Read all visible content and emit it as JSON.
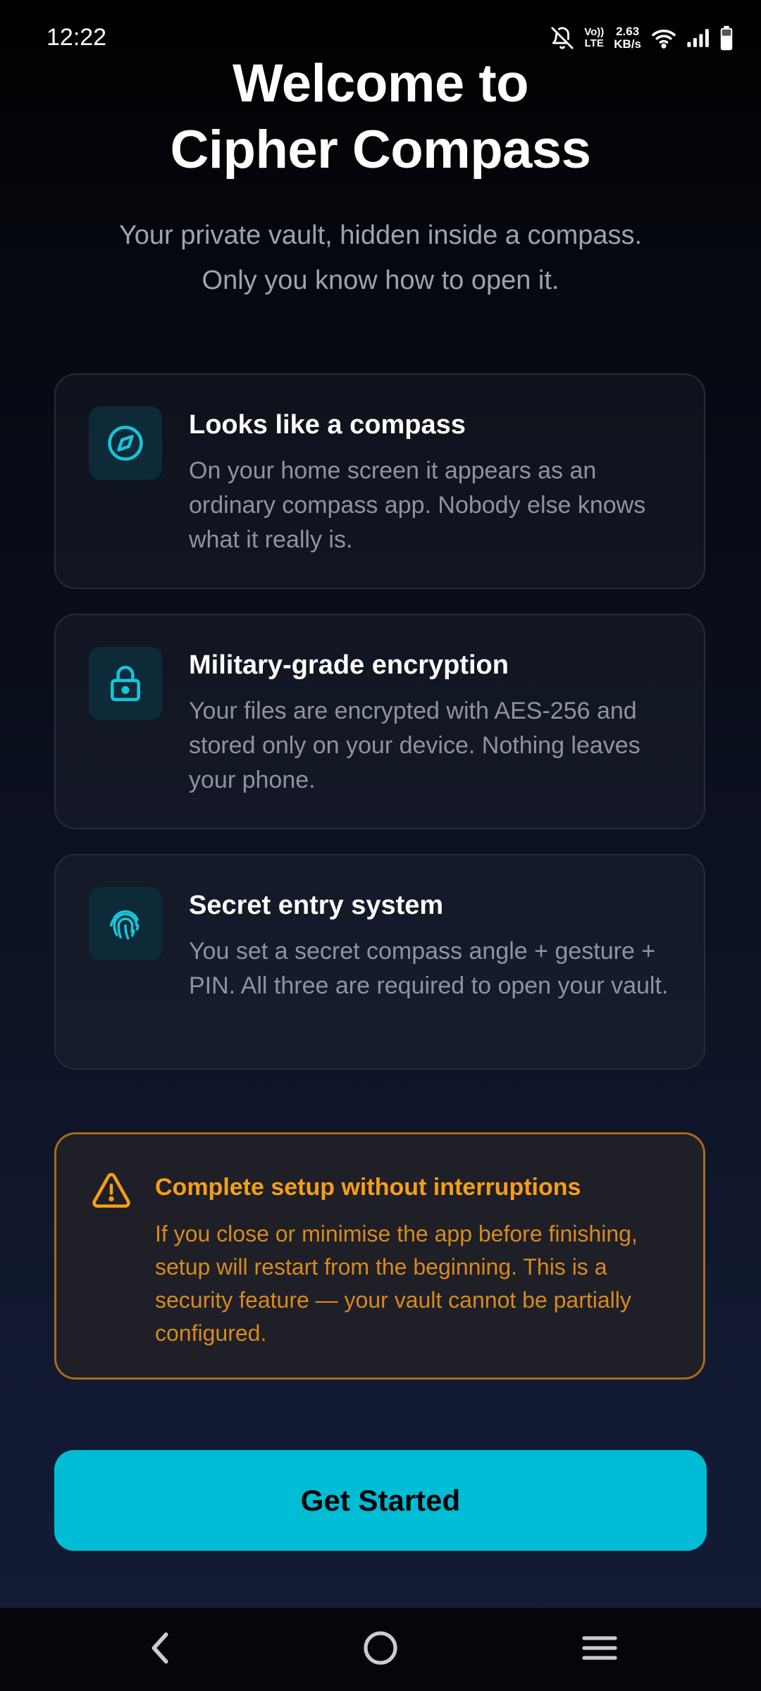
{
  "status_bar": {
    "time": "12:22",
    "volte_top": "Vo))",
    "volte_bottom": "LTE",
    "speed_value": "2.63",
    "speed_unit": "KB/s",
    "icons": [
      "notifications-off-icon",
      "volte-icon",
      "wifi-icon",
      "signal-icon",
      "battery-icon"
    ]
  },
  "header": {
    "title_line1": "Welcome to",
    "title_line2": "Cipher Compass",
    "subtitle_line1": "Your private vault, hidden inside a compass.",
    "subtitle_line2": "Only you know how to open it."
  },
  "features": [
    {
      "icon": "compass-icon",
      "title": "Looks like a compass",
      "description": "On your home screen it appears as an ordinary compass app. Nobody else knows what it really is."
    },
    {
      "icon": "lock-icon",
      "title": "Military-grade encryption",
      "description": "Your files are encrypted with AES-256 and stored only on your device. Nothing leaves your phone."
    },
    {
      "icon": "fingerprint-icon",
      "title": "Secret entry system",
      "description": "You set a secret compass angle + gesture + PIN. All three are required to open your vault."
    }
  ],
  "warning": {
    "icon": "warning-icon",
    "title": "Complete setup without interruptions",
    "text": "If you close or minimise the app before finishing, setup will restart from the beginning. This is a security feature — your vault cannot be partially configured."
  },
  "actions": {
    "get_started_label": "Get Started"
  },
  "nav": {
    "icons": [
      "back-icon",
      "home-icon",
      "recents-icon"
    ]
  },
  "colors": {
    "accent": "#00BCD4",
    "warning": "#F59E1A",
    "background_top": "#000000",
    "background_bottom": "#141C36"
  }
}
